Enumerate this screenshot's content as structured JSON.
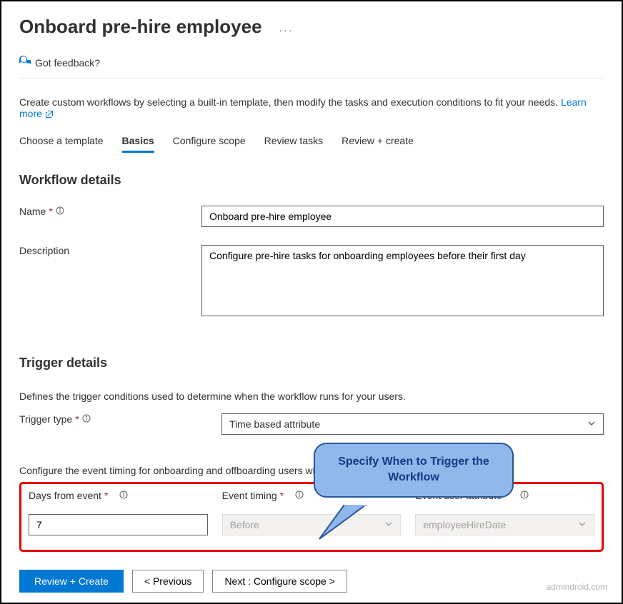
{
  "header": {
    "title": "Onboard pre-hire employee",
    "ellipsis": "···",
    "feedback_label": "Got feedback?"
  },
  "intro": {
    "text": "Create custom workflows by selecting a built-in template, then modify the tasks and execution conditions to fit your needs.",
    "learn_more": "Learn more"
  },
  "tabs": {
    "choose": "Choose a template",
    "basics": "Basics",
    "configure": "Configure scope",
    "review_tasks": "Review tasks",
    "review_create": "Review + create"
  },
  "workflow": {
    "section_title": "Workflow details",
    "name_label": "Name",
    "name_value": "Onboard pre-hire employee",
    "description_label": "Description",
    "description_value": "Configure pre-hire tasks for onboarding employees before their first day"
  },
  "trigger": {
    "section_title": "Trigger details",
    "description": "Defines the trigger conditions used to determine when the workflow runs for your users.",
    "type_label": "Trigger type",
    "type_value": "Time based attribute",
    "config_text": "Configure the event timing for onboarding and offboarding users within",
    "days_label": "Days from event",
    "days_value": "7",
    "timing_label": "Event timing",
    "timing_value": "Before",
    "attr_label": "Event user attribute",
    "attr_value": "employeeHireDate"
  },
  "callout": {
    "text": "Specify When to Trigger the Workflow"
  },
  "footer": {
    "review_create": "Review + Create",
    "previous": "< Previous",
    "next": "Next : Configure scope >"
  },
  "watermark": "admindroid.com"
}
